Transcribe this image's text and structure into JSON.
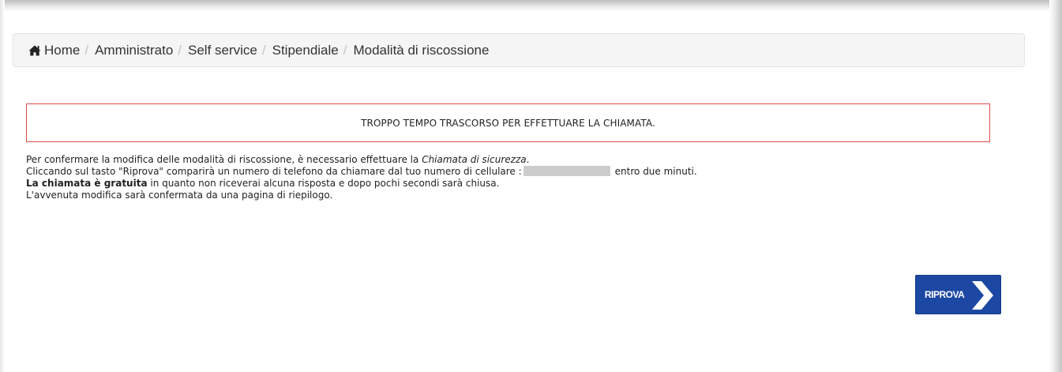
{
  "breadcrumb": {
    "items": [
      "Home",
      "Amministrato",
      "Self service",
      "Stipendiale",
      "Modalità di riscossione"
    ],
    "separator": "/",
    "home_icon": "home-icon"
  },
  "alert": {
    "message": "TROPPO TEMPO TRASCORSO PER EFFETTUARE LA CHIAMATA.",
    "border_color": "#e04a4a"
  },
  "info": {
    "line1_prefix": "Per confermare la modifica delle modalità di riscossione, è necessario effettuare la ",
    "line1_emphasis": "Chiamata di sicurezza",
    "line1_suffix": ".",
    "line2_prefix": "Cliccando sul tasto \"Riprova\" comparirà un numero di telefono da chiamare dal tuo numero di cellulare :",
    "line2_suffix": "entro due minuti.",
    "line3_bold": "La chiamata è gratuita",
    "line3_rest": " in quanto non riceverai alcuna risposta e dopo pochi secondi sarà chiusa.",
    "line4": "L'avvenuta modifica sarà confermata da una pagina di riepilogo."
  },
  "retry_button": {
    "label": "RIPROVA",
    "icon": "chevron-right-icon",
    "color": "#1c47a3"
  }
}
